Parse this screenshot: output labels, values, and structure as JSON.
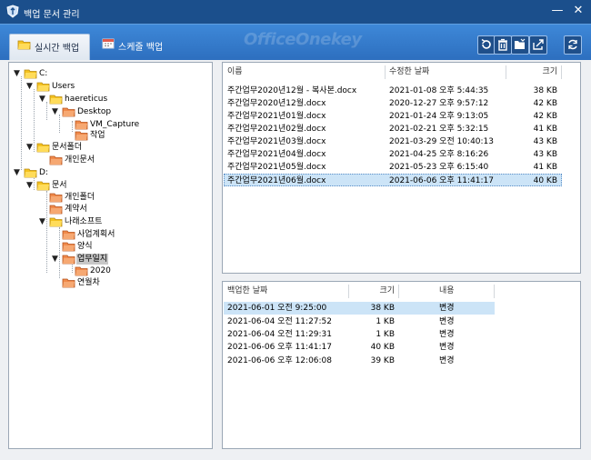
{
  "window": {
    "title": "백업 문서 관리",
    "minimize": "—",
    "close": "✕"
  },
  "tabs": {
    "live": "실시간 백업",
    "schedule": "스케줄 백업"
  },
  "brand": "OfficeOnekey",
  "toolbar_icons": [
    "restore-icon",
    "delete-icon",
    "open-folder-icon",
    "export-icon",
    "refresh-icon"
  ],
  "tree": [
    {
      "label": "C:",
      "toggle": "▼",
      "depth": 0
    },
    {
      "label": "Users",
      "toggle": "▼",
      "depth": 1
    },
    {
      "label": "haereticus",
      "toggle": "▼",
      "depth": 2
    },
    {
      "label": "Desktop",
      "toggle": "▼",
      "depth": 3
    },
    {
      "label": "VM_Capture",
      "toggle": "",
      "depth": 4
    },
    {
      "label": "작업",
      "toggle": "",
      "depth": 4
    },
    {
      "label": "문서폴더",
      "toggle": "▼",
      "depth": 1
    },
    {
      "label": "개인문서",
      "toggle": "",
      "depth": 2
    },
    {
      "label": "D:",
      "toggle": "▼",
      "depth": 0
    },
    {
      "label": "문서",
      "toggle": "▼",
      "depth": 1
    },
    {
      "label": "개인폴더",
      "toggle": "",
      "depth": 2
    },
    {
      "label": "계약서",
      "toggle": "",
      "depth": 2
    },
    {
      "label": "나래소프트",
      "toggle": "▼",
      "depth": 2
    },
    {
      "label": "사업계획서",
      "toggle": "",
      "depth": 3
    },
    {
      "label": "양식",
      "toggle": "",
      "depth": 3
    },
    {
      "label": "업무일지",
      "toggle": "▼",
      "depth": 3,
      "selected": true
    },
    {
      "label": "2020",
      "toggle": "",
      "depth": 4
    },
    {
      "label": "연월차",
      "toggle": "",
      "depth": 3
    }
  ],
  "files": {
    "columns": {
      "name": "이름",
      "modified": "수정한 날짜",
      "size": "크기"
    },
    "rows": [
      {
        "name": "주간업무2020년12월 - 복사본.docx",
        "modified": "2021-01-08 오후 5:44:35",
        "size": "38 KB"
      },
      {
        "name": "주간업무2020년12월.docx",
        "modified": "2020-12-27 오후 9:57:12",
        "size": "42 KB"
      },
      {
        "name": "주간업무2021년01월.docx",
        "modified": "2021-01-24 오후 9:13:05",
        "size": "42 KB"
      },
      {
        "name": "주간업무2021년02월.docx",
        "modified": "2021-02-21 오후 5:32:15",
        "size": "41 KB"
      },
      {
        "name": "주간업무2021년03월.docx",
        "modified": "2021-03-29 오전 10:40:13",
        "size": "43 KB"
      },
      {
        "name": "주간업무2021년04월.docx",
        "modified": "2021-04-25 오후 8:16:26",
        "size": "43 KB"
      },
      {
        "name": "주간업무2021년05월.docx",
        "modified": "2021-05-23 오후 6:15:40",
        "size": "41 KB"
      },
      {
        "name": "주간업무2021년06월.docx",
        "modified": "2021-06-06 오후 11:41:17",
        "size": "40 KB",
        "selected": true
      }
    ]
  },
  "history": {
    "columns": {
      "date": "백업한 날짜",
      "size": "크기",
      "content": "내용"
    },
    "rows": [
      {
        "date": "2021-06-01 오전 9:25:00",
        "size": "38 KB",
        "content": "변경",
        "selected": true
      },
      {
        "date": "2021-06-04 오전 11:27:52",
        "size": "1 KB",
        "content": "변경"
      },
      {
        "date": "2021-06-04 오전 11:29:31",
        "size": "1 KB",
        "content": "변경"
      },
      {
        "date": "2021-06-06 오후 11:41:17",
        "size": "40 KB",
        "content": "변경"
      },
      {
        "date": "2021-06-06 오후 12:06:08",
        "size": "39 KB",
        "content": "변경"
      }
    ]
  }
}
